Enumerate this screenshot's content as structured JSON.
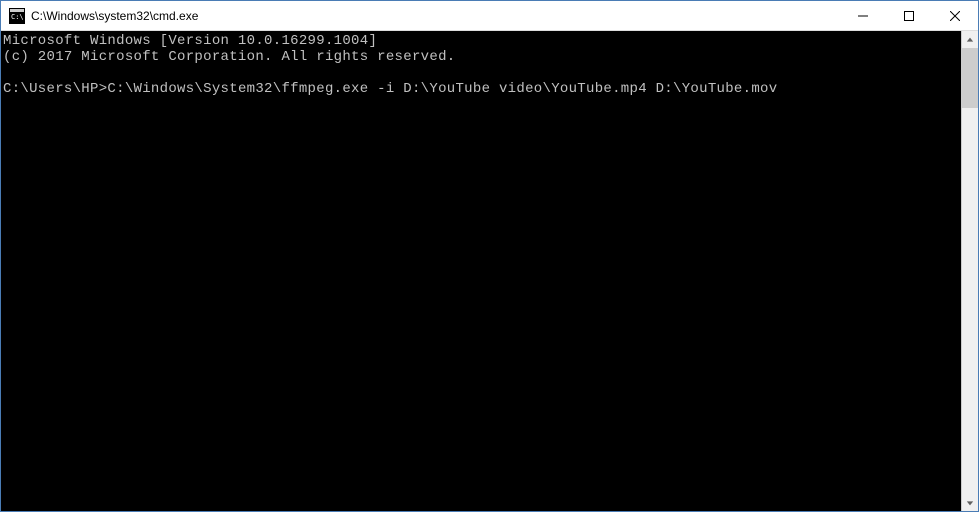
{
  "titlebar": {
    "title": "C:\\Windows\\system32\\cmd.exe"
  },
  "console": {
    "line1": "Microsoft Windows [Version 10.0.16299.1004]",
    "line2": "(c) 2017 Microsoft Corporation. All rights reserved.",
    "blank1": "",
    "prompt": "C:\\Users\\HP>",
    "command": "C:\\Windows\\System32\\ffmpeg.exe -i D:\\YouTube video\\YouTube.mp4 D:\\YouTube.mov"
  }
}
